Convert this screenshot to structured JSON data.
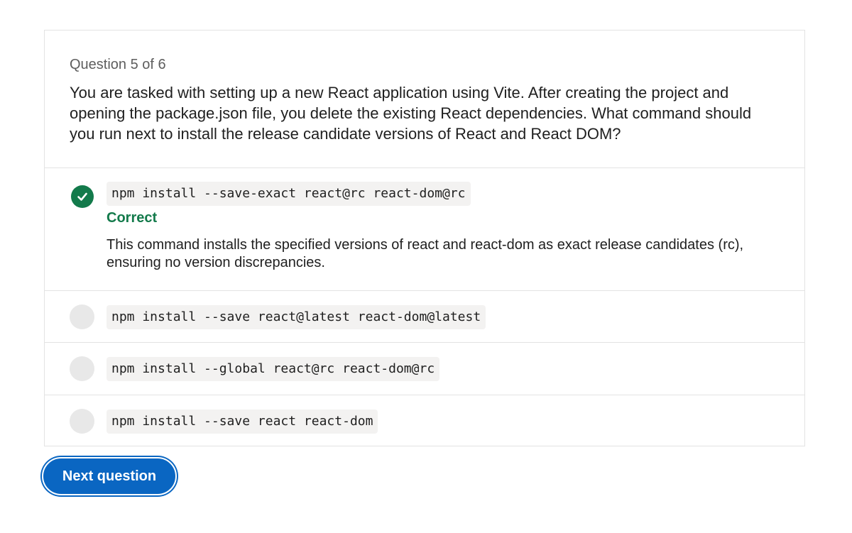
{
  "question": {
    "counter": "Question 5 of 6",
    "text": "You are tasked with setting up a new React application using Vite. After creating the project and opening the package.json file, you delete the existing React dependencies. What command should you run next to install the release candidate versions of React and React DOM?"
  },
  "options": [
    {
      "code": "npm install --save-exact react@rc react-dom@rc",
      "selected": true,
      "state": "correct",
      "feedback_status": "Correct",
      "feedback_text": "This command installs the specified versions of react and react-dom as exact release candidates (rc), ensuring no version discrepancies."
    },
    {
      "code": "npm install --save react@latest react-dom@latest",
      "selected": false
    },
    {
      "code": "npm install --global react@rc react-dom@rc",
      "selected": false
    },
    {
      "code": "npm install --save react react-dom",
      "selected": false
    }
  ],
  "actions": {
    "next_label": "Next question"
  },
  "colors": {
    "correct": "#137a4b",
    "primary_button": "#0a66c2",
    "radio_unselected": "#e8e8e8",
    "code_background": "#f3f2f1"
  },
  "icons": {
    "correct": "checkmark-icon"
  }
}
